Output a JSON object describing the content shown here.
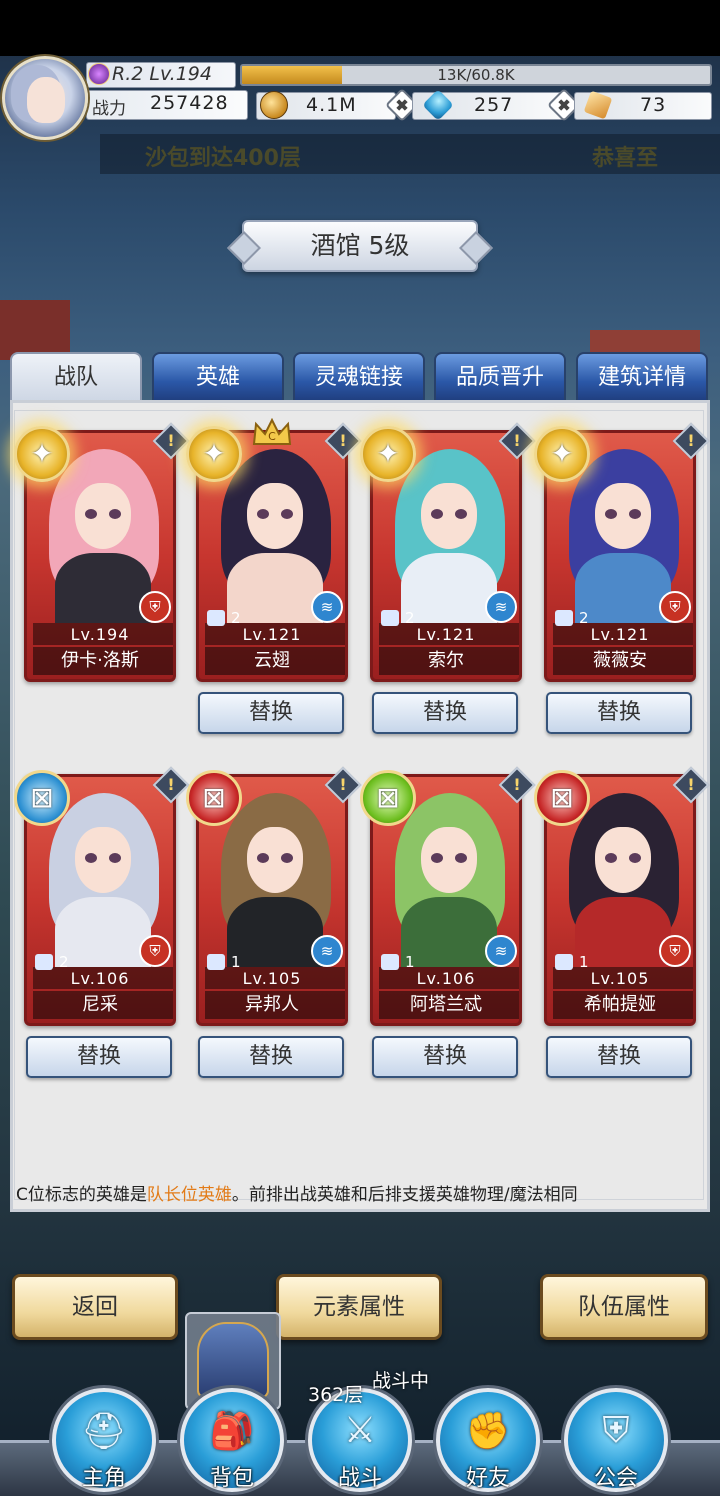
{
  "player": {
    "rank": "R.2 Lv.194",
    "exp_text": "13K/60.8K",
    "exp_progress": 0.214,
    "power_label": "战力",
    "power_value": "257428",
    "gold": "4.1M",
    "diamonds": "257",
    "cards": "73"
  },
  "marquee": {
    "left": "沙包到达400层",
    "right": "恭喜至"
  },
  "title": "酒馆 5级",
  "tabs": [
    {
      "label": "战队",
      "active": true
    },
    {
      "label": "英雄",
      "active": false
    },
    {
      "label": "灵魂链接",
      "active": false
    },
    {
      "label": "品质晋升",
      "active": false
    },
    {
      "label": "建筑详情",
      "active": false
    }
  ],
  "heroes": [
    {
      "name": "伊卡·洛斯",
      "level": "Lv.194",
      "element": "gold",
      "role": "red",
      "badge": "",
      "leader": false
    },
    {
      "name": "云翅",
      "level": "Lv.121",
      "element": "gold",
      "role": "blue",
      "badge": "2",
      "leader": true
    },
    {
      "name": "索尔",
      "level": "Lv.121",
      "element": "gold",
      "role": "blue",
      "badge": "2",
      "leader": false
    },
    {
      "name": "薇薇安",
      "level": "Lv.121",
      "element": "gold",
      "role": "red",
      "badge": "2",
      "leader": false
    },
    {
      "name": "尼采",
      "level": "Lv.106",
      "element": "blue",
      "role": "red",
      "badge": "2",
      "leader": false
    },
    {
      "name": "异邦人",
      "level": "Lv.105",
      "element": "red",
      "role": "blue",
      "badge": "1",
      "leader": false
    },
    {
      "name": "阿塔兰忒",
      "level": "Lv.106",
      "element": "green",
      "role": "blue",
      "badge": "1",
      "leader": false
    },
    {
      "name": "希帕提娅",
      "level": "Lv.105",
      "element": "red",
      "role": "red",
      "badge": "1",
      "leader": false
    }
  ],
  "swap_label": "替换",
  "tip": {
    "before": "C位标志的英雄是",
    "highlight": "队长位英雄",
    "after": "。前排出战英雄和后排支援英雄物理/魔法相同"
  },
  "buttons": {
    "back": "返回",
    "element_attr": "元素属性",
    "team_attr": "队伍属性"
  },
  "battle": {
    "floor": "362层",
    "status": "战斗中"
  },
  "nav": [
    {
      "label": "主角",
      "icon": "helmet-icon"
    },
    {
      "label": "背包",
      "icon": "backpack-icon"
    },
    {
      "label": "战斗",
      "icon": "crossed-swords-icon"
    },
    {
      "label": "好友",
      "icon": "handshake-icon"
    },
    {
      "label": "公会",
      "icon": "guild-emblem-icon"
    }
  ],
  "colors": {
    "tab_blue": "#2b58a8",
    "card_red": "#c7362f",
    "tip_highlight": "#e27b18",
    "nav_blue": "#2a9ed8"
  }
}
